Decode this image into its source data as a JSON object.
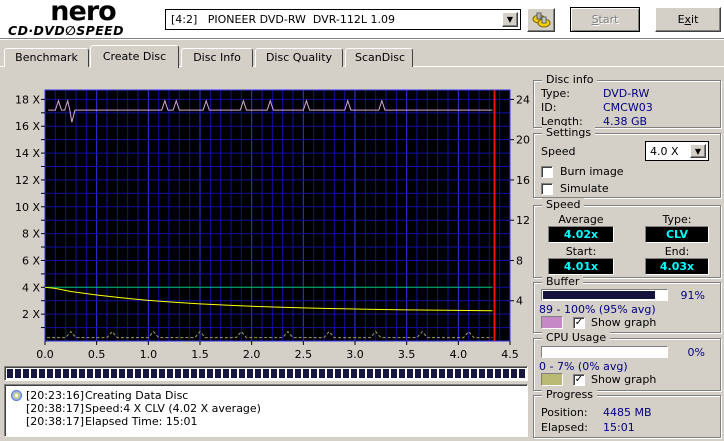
{
  "toolbar": {
    "brand_line1": "nero",
    "brand_line2": "CD·DVD∅SPEED",
    "drive_select": "[4:2]   PIONEER DVD-RW  DVR-112L 1.09",
    "start": {
      "u": "S",
      "rest": "tart"
    },
    "exit": {
      "pre": "E",
      "u": "x",
      "rest": "it"
    }
  },
  "tabs": [
    "Benchmark",
    "Create Disc",
    "Disc Info",
    "Disc Quality",
    "ScanDisc"
  ],
  "chart_data": {
    "type": "line",
    "x_axis": {
      "min": 0,
      "max": 4.5,
      "minor_step": 0.1,
      "major_step": 0.5,
      "tick_labels": [
        "0.0",
        "0.5",
        "1.0",
        "1.5",
        "2.0",
        "2.5",
        "3.0",
        "3.5",
        "4.0",
        "4.5"
      ],
      "unit": "GB"
    },
    "left_axis": {
      "min": 0,
      "max": 18.7,
      "grid_step": 1,
      "ticks": [
        2,
        4,
        6,
        8,
        10,
        12,
        14,
        16,
        18
      ],
      "suffix": " X"
    },
    "right_axis": {
      "ticks": [
        4,
        8,
        12,
        16,
        20,
        24
      ],
      "scale_to_left": 0.75
    },
    "bg": "#000000",
    "grid_minor_color": "#1010a8",
    "grid_major_color": "#3333ee",
    "frame_color": "#3333ee",
    "series": [
      {
        "name": "buffer-level",
        "color": "#d9a7d9",
        "width": 1,
        "points": [
          [
            0.03,
            17.2
          ],
          [
            0.1,
            17.2
          ],
          [
            0.13,
            17.9
          ],
          [
            0.16,
            17.2
          ],
          [
            0.19,
            17.2
          ],
          [
            0.22,
            17.9
          ],
          [
            0.24,
            17.2
          ],
          [
            0.26,
            16.3
          ],
          [
            0.29,
            17.2
          ],
          [
            1.13,
            17.2
          ],
          [
            1.16,
            17.9
          ],
          [
            1.19,
            17.2
          ],
          [
            1.24,
            17.2
          ],
          [
            1.27,
            17.9
          ],
          [
            1.3,
            17.2
          ],
          [
            1.53,
            17.2
          ],
          [
            1.56,
            17.9
          ],
          [
            1.59,
            17.2
          ],
          [
            1.89,
            17.2
          ],
          [
            1.92,
            17.9
          ],
          [
            1.95,
            17.2
          ],
          [
            2.15,
            17.2
          ],
          [
            2.18,
            17.9
          ],
          [
            2.21,
            17.2
          ],
          [
            2.5,
            17.2
          ],
          [
            2.53,
            17.9
          ],
          [
            2.56,
            17.2
          ],
          [
            2.9,
            17.2
          ],
          [
            2.93,
            17.9
          ],
          [
            2.96,
            17.2
          ],
          [
            3.23,
            17.2
          ],
          [
            3.26,
            17.9
          ],
          [
            3.29,
            17.2
          ],
          [
            4.33,
            17.2
          ]
        ]
      },
      {
        "name": "write-speed",
        "color": "#00c060",
        "width": 1,
        "points": [
          [
            0.02,
            4.0
          ],
          [
            4.33,
            4.0
          ]
        ]
      },
      {
        "name": "rotation-curve",
        "color": "#ffff00",
        "width": 1,
        "points": [
          [
            0.0,
            4.0
          ],
          [
            0.1,
            3.92
          ],
          [
            0.25,
            3.69
          ],
          [
            0.5,
            3.43
          ],
          [
            0.75,
            3.21
          ],
          [
            1.0,
            3.03
          ],
          [
            1.25,
            2.89
          ],
          [
            1.5,
            2.77
          ],
          [
            1.75,
            2.67
          ],
          [
            2.0,
            2.59
          ],
          [
            2.25,
            2.52
          ],
          [
            2.5,
            2.47
          ],
          [
            2.75,
            2.42
          ],
          [
            3.0,
            2.38
          ],
          [
            3.25,
            2.35
          ],
          [
            3.5,
            2.32
          ],
          [
            3.75,
            2.3
          ],
          [
            4.0,
            2.28
          ],
          [
            4.2,
            2.26
          ],
          [
            4.33,
            2.25
          ]
        ]
      },
      {
        "name": "cpu-usage",
        "color": "#9f9f60",
        "width": 1,
        "dash": "3,2",
        "points": [
          [
            0.02,
            0.25
          ],
          [
            0.2,
            0.25
          ],
          [
            0.25,
            0.7
          ],
          [
            0.3,
            0.25
          ],
          [
            0.6,
            0.25
          ],
          [
            0.65,
            0.7
          ],
          [
            0.7,
            0.25
          ],
          [
            1.0,
            0.25
          ],
          [
            1.05,
            0.7
          ],
          [
            1.1,
            0.25
          ],
          [
            1.45,
            0.25
          ],
          [
            1.5,
            0.7
          ],
          [
            1.55,
            0.25
          ],
          [
            1.85,
            0.25
          ],
          [
            1.9,
            0.7
          ],
          [
            1.95,
            0.25
          ],
          [
            2.3,
            0.25
          ],
          [
            2.35,
            0.7
          ],
          [
            2.4,
            0.25
          ],
          [
            2.7,
            0.25
          ],
          [
            2.75,
            0.7
          ],
          [
            2.8,
            0.25
          ],
          [
            3.15,
            0.25
          ],
          [
            3.2,
            0.7
          ],
          [
            3.25,
            0.25
          ],
          [
            3.6,
            0.25
          ],
          [
            3.65,
            0.7
          ],
          [
            3.7,
            0.25
          ],
          [
            4.05,
            0.25
          ],
          [
            4.1,
            0.7
          ],
          [
            4.15,
            0.25
          ],
          [
            4.33,
            0.25
          ]
        ]
      }
    ],
    "end_marker": {
      "x": 4.35,
      "color": "#ee1111"
    }
  },
  "burn_progress": {
    "fill_percent": 100
  },
  "log": {
    "entries": [
      {
        "time": "[20:23:16]",
        "text": "Creating Data Disc"
      },
      {
        "time": "[20:38:17]",
        "text": "Speed:4 X CLV (4.02 X average)"
      },
      {
        "time": "[20:38:17]",
        "text": "Elapsed Time: 15:01"
      }
    ]
  },
  "disc_info": {
    "title": "Disc info",
    "type_label": "Type:",
    "type": "DVD-RW",
    "id_label": "ID:",
    "id": "CMCW03",
    "length_label": "Length:",
    "length": "4.38 GB"
  },
  "settings": {
    "title": "Settings",
    "speed_label": "Speed",
    "speed_value": "4.0 X",
    "burn_image": "Burn image",
    "simulate": "Simulate"
  },
  "speed": {
    "title": "Speed",
    "average_label": "Average",
    "average": "4.02x",
    "type_label": "Type:",
    "type": "CLV",
    "start_label": "Start:",
    "start": "4.01x",
    "end_label": "End:",
    "end": "4.03x"
  },
  "buffer": {
    "title": "Buffer",
    "percent": "91%",
    "fill_percent": 91,
    "range": "89 - 100% (95% avg)",
    "show_graph": "Show graph",
    "swatch_color": "#c788c7",
    "check": "✓"
  },
  "cpu": {
    "title": "CPU Usage",
    "percent": "0%",
    "fill_percent": 0,
    "range": "0 - 7% (0% avg)",
    "show_graph": "Show graph",
    "swatch_color": "#b9b973",
    "check": "✓"
  },
  "progress": {
    "title": "Progress",
    "position_label": "Position:",
    "position": "4485 MB",
    "elapsed_label": "Elapsed:",
    "elapsed": "15:01"
  }
}
